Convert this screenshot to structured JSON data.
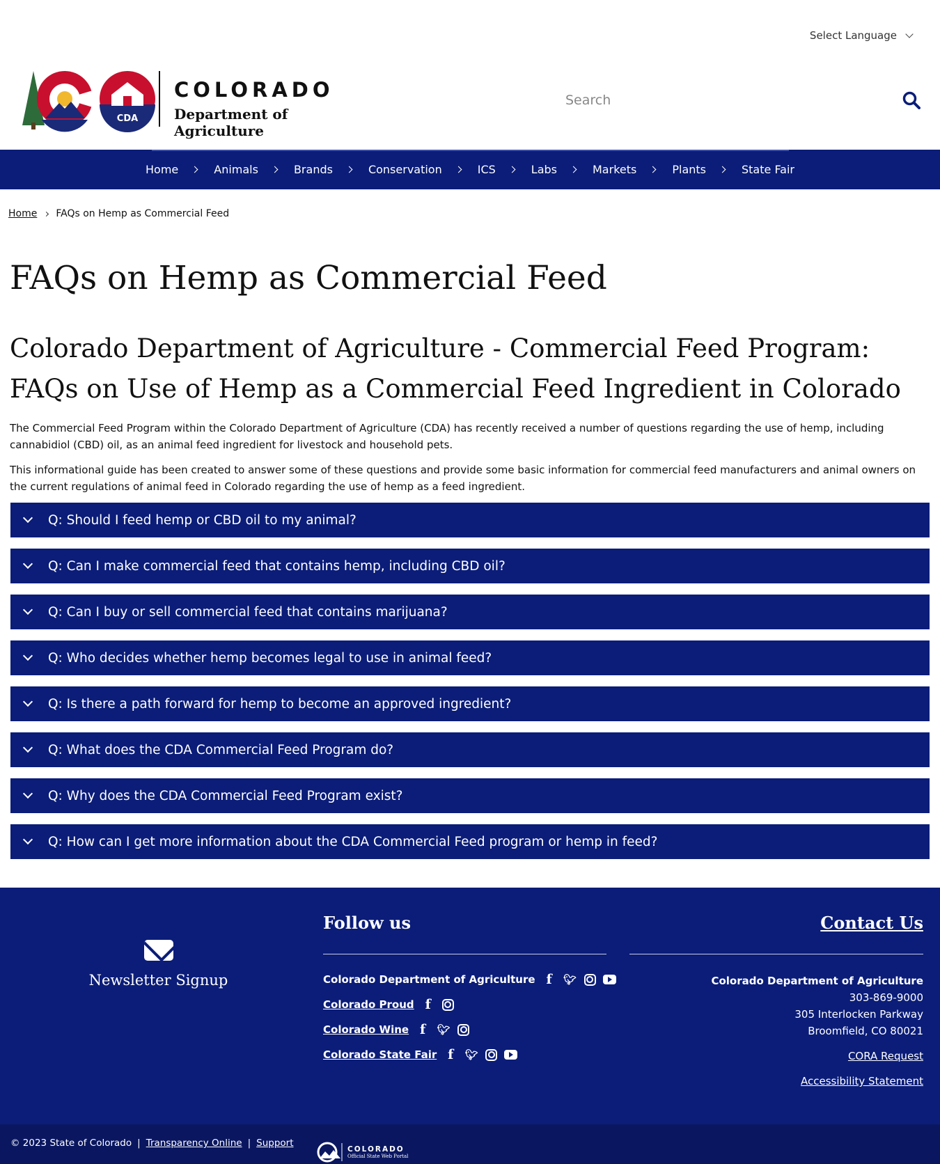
{
  "header": {
    "language_label": "Select Language",
    "logo_line1": "COLORADO",
    "logo_line2": "Department of Agriculture",
    "logo_badge": "CDA",
    "search_placeholder": "Search"
  },
  "nav": {
    "items": [
      "Home",
      "Animals",
      "Brands",
      "Conservation",
      "ICS",
      "Labs",
      "Markets",
      "Plants",
      "State Fair"
    ]
  },
  "breadcrumb": {
    "home": "Home",
    "current": "FAQs on Hemp as Commercial Feed"
  },
  "main": {
    "title": "FAQs on Hemp as Commercial Feed",
    "subtitle": "Colorado Department of Agriculture - Commercial Feed Program: FAQs on Use of Hemp as a Commercial Feed Ingredient in Colorado",
    "paragraph1": "The Commercial Feed Program within the Colorado Department of Agriculture (CDA) has recently received a number of questions regarding the use of hemp, including cannabidiol (CBD) oil, as an animal feed ingredient for livestock and household pets.",
    "paragraph2": "This informational guide has been created to answer some of these questions and provide some basic information for commercial feed manufacturers and animal owners on the current regulations of animal feed in Colorado regarding the use of hemp as a feed ingredient.",
    "faqs": [
      "Q: Should I feed hemp or CBD oil to my animal?",
      "Q: Can I make commercial feed that contains hemp, including CBD oil?",
      "Q: Can I buy or sell commercial feed that contains marijuana?",
      "Q: Who decides whether hemp becomes legal to use in animal feed?",
      "Q: Is there a path forward for hemp to become an approved ingredient?",
      "Q: What does the CDA Commercial Feed Program do?",
      "Q: Why does the CDA Commercial Feed Program exist?",
      "Q: How can I get more information about the CDA Commercial Feed program or hemp in feed?"
    ]
  },
  "footer": {
    "newsletter": "Newsletter Signup",
    "follow_title": "Follow us",
    "follow_rows": [
      {
        "name": "Colorado Department of Agriculture",
        "icons": [
          "facebook-icon",
          "twitter-icon",
          "instagram-icon",
          "youtube-icon"
        ]
      },
      {
        "name": "Colorado Proud",
        "icons": [
          "facebook-icon",
          "instagram-icon"
        ]
      },
      {
        "name": "Colorado Wine",
        "icons": [
          "facebook-icon",
          "twitter-icon",
          "instagram-icon"
        ]
      },
      {
        "name": "Colorado State Fair",
        "icons": [
          "facebook-icon",
          "twitter-icon",
          "instagram-icon",
          "youtube-icon"
        ]
      }
    ],
    "contact_title": "Contact Us",
    "org": "Colorado Department of Agriculture",
    "phone": "303-869-9000",
    "street": "305 Interlocken Parkway",
    "city": "Broomfield, CO 80021",
    "cora": "CORA Request",
    "accessibility": "Accessibility Statement",
    "copyright": "© 2023 State of Colorado",
    "transparency": "Transparency Online",
    "support": "Support",
    "portal_line1": "COLORADO",
    "portal_line2": "Official State Web Portal"
  },
  "colors": {
    "primary": "#0b1d78",
    "footer_bottom": "#0a1760",
    "logo_red": "#c8102e",
    "logo_navy": "#1a2a78",
    "logo_gold": "#f1b82d",
    "logo_green": "#2e6b3a"
  }
}
